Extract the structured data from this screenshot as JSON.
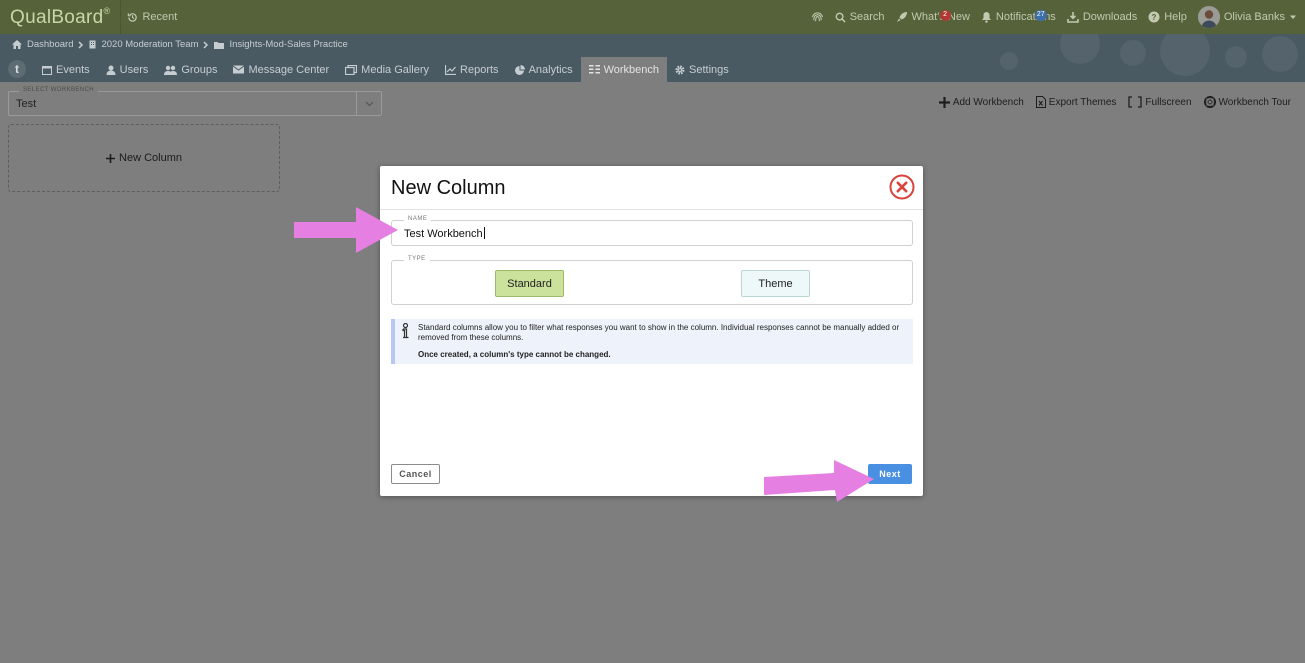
{
  "app": {
    "logo": "QualBoard",
    "logo_mark": "®",
    "recent": "Recent"
  },
  "top_nav": {
    "search": "Search",
    "whats_new": "What's New",
    "whats_new_badge": "2",
    "notifications": "Notifications",
    "notifications_badge": "27",
    "downloads": "Downloads",
    "help": "Help",
    "user": "Olivia Banks"
  },
  "breadcrumb": [
    "Dashboard",
    "2020 Moderation Team",
    "Insights-Mod-Sales Practice"
  ],
  "tabs": [
    {
      "label": "Events",
      "icon": "calendar-icon"
    },
    {
      "label": "Users",
      "icon": "user-icon"
    },
    {
      "label": "Groups",
      "icon": "users-icon"
    },
    {
      "label": "Message Center",
      "icon": "envelope-icon"
    },
    {
      "label": "Media Gallery",
      "icon": "images-icon"
    },
    {
      "label": "Reports",
      "icon": "line-chart-icon"
    },
    {
      "label": "Analytics",
      "icon": "pie-chart-icon"
    },
    {
      "label": "Workbench",
      "icon": "columns-icon",
      "active": true
    },
    {
      "label": "Settings",
      "icon": "gear-icon"
    }
  ],
  "workbench": {
    "select_label": "SELECT WORKBENCH",
    "select_value": "Test",
    "new_column": "New Column",
    "actions": {
      "add": "Add Workbench",
      "export": "Export Themes",
      "fullscreen": "Fullscreen",
      "tour": "Workbench Tour"
    }
  },
  "modal": {
    "title": "New Column",
    "name_label": "NAME",
    "name_value": "Test Workbench",
    "type_label": "TYPE",
    "type_options": [
      "Standard",
      "Theme"
    ],
    "type_selected": "Standard",
    "info_text": "Standard columns allow you to filter what responses you want to show in the column. Individual responses cannot be manually added or removed from these columns.",
    "info_bold": "Once created, a column's type cannot be changed.",
    "cancel": "Cancel",
    "next": "Next"
  },
  "colors": {
    "topbar": "#56633a",
    "header": "#4a5a63",
    "overlay": "#7e7e7e",
    "standard_selected": "#cbe29d",
    "next_button": "#4a90e2",
    "close_icon": "#d9443f",
    "annotation_arrow": "#e67fe2"
  }
}
